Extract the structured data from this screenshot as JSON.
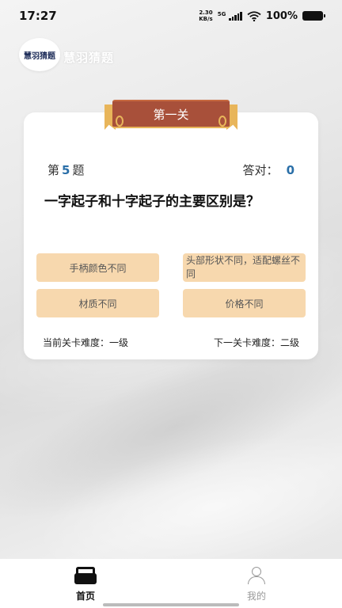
{
  "status_bar": {
    "time": "17:27",
    "net_speed_value": "2.30",
    "net_speed_unit": "KB/s",
    "network_type": "5G",
    "battery": "100%"
  },
  "header": {
    "logo_text": "慧羽猜题",
    "app_name": "慧羽猜题"
  },
  "quiz": {
    "level_title": "第一关",
    "question_prefix": "第",
    "question_number": "5",
    "question_suffix": "题",
    "score_label": "答对：",
    "score_value": "0",
    "question_text": "一字起子和十字起子的主要区别是？",
    "options": [
      "手柄颜色不同",
      "头部形状不同，适配螺丝不同",
      "材质不同",
      "价格不同"
    ],
    "current_level": "当前关卡难度：一级",
    "next_level": "下一关卡难度：二级"
  },
  "bottom_nav": {
    "home_label": "首页",
    "mine_label": "我的"
  }
}
